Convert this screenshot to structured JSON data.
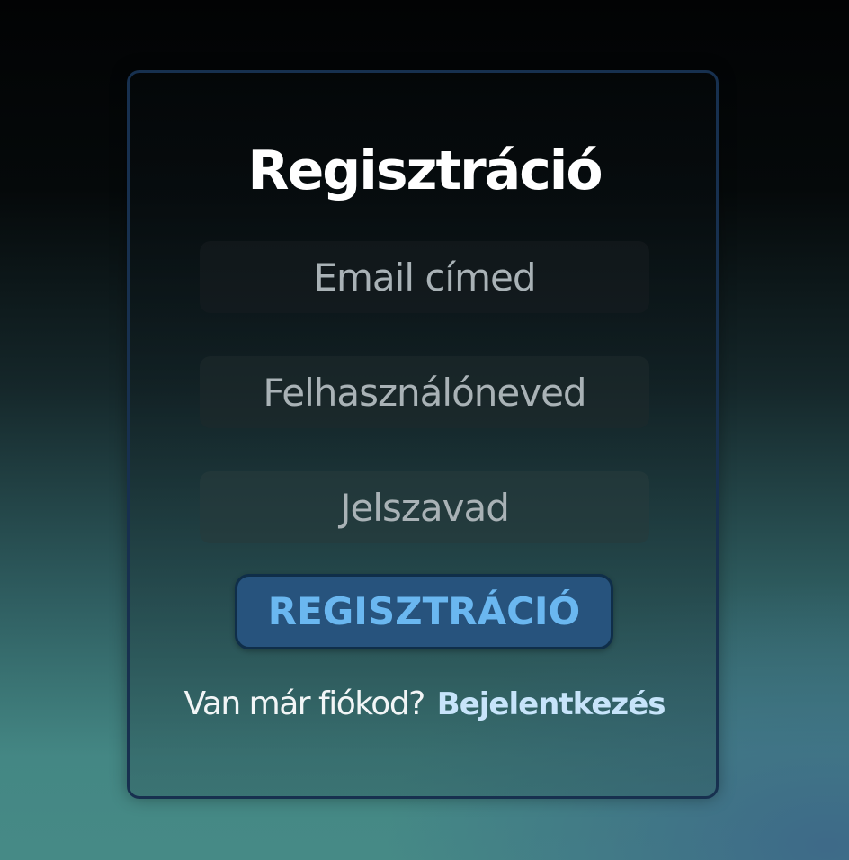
{
  "form": {
    "title": "Regisztráció",
    "email_placeholder": "Email címed",
    "username_placeholder": "Felhasználóneved",
    "password_placeholder": "Jelszavad",
    "submit_label": "REGISZTRÁCIÓ"
  },
  "footer": {
    "prompt": "Van már fiókod?",
    "login_link": "Bejelentkezés"
  },
  "colors": {
    "accent": "#6ab7f0",
    "button_bg": "#27537d",
    "card_border": "#17304f"
  }
}
